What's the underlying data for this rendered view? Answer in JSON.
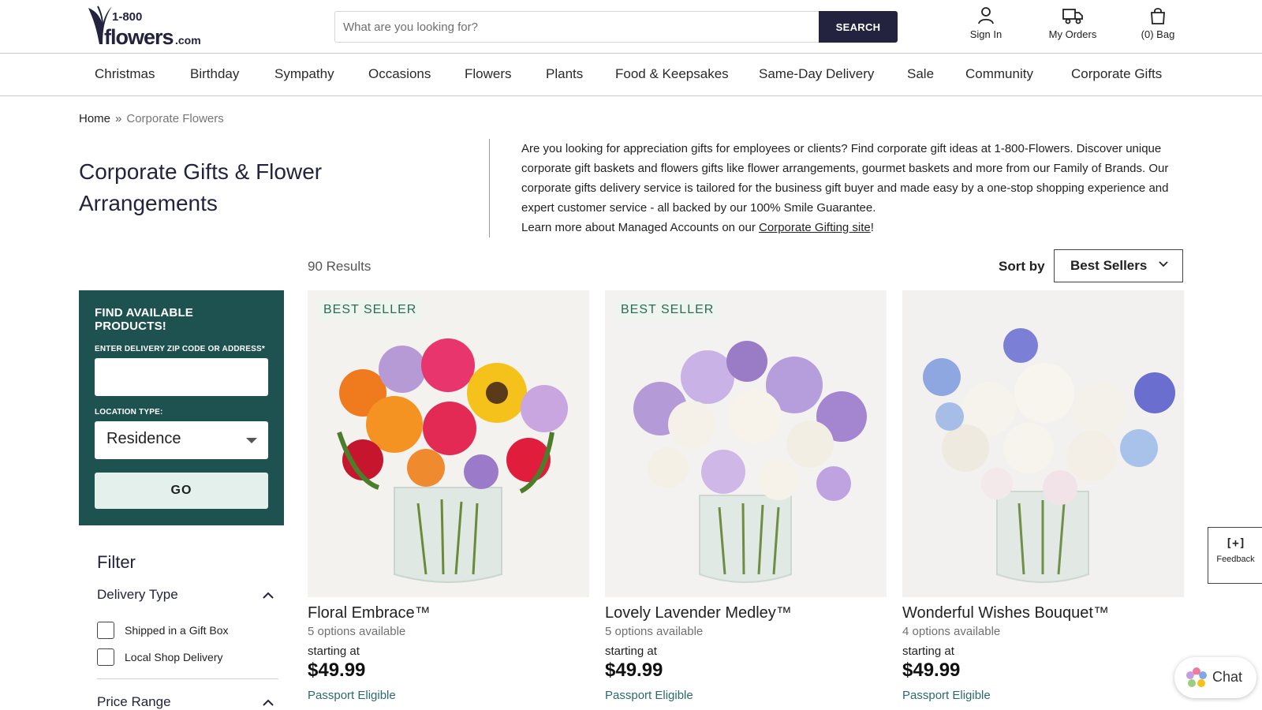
{
  "header": {
    "logo_text": "1-800-flowers.com",
    "search_placeholder": "What are you looking for?",
    "search_label": "SEARCH",
    "signin_label": "Sign In",
    "orders_label": "My Orders",
    "bag_label": "(0) Bag"
  },
  "nav": {
    "items": [
      "Christmas",
      "Birthday",
      "Sympathy",
      "Occasions",
      "Flowers",
      "Plants",
      "Food & Keepsakes",
      "Same-Day Delivery",
      "Sale",
      "Community",
      "Corporate Gifts"
    ]
  },
  "breadcrumb": {
    "home": "Home",
    "separator": "»",
    "current": "Corporate Flowers"
  },
  "page": {
    "title": "Corporate Gifts & Flower Arrangements",
    "description": "Are you looking for appreciation gifts for employees or clients? Find corporate gift ideas at 1-800-Flowers. Discover unique corporate gift baskets and flowers gifts like flower arrangements, gourmet baskets and more from our Family of Brands. Our corporate gifts delivery service is tailored for the business gift buyer and made easy by a one-stop shopping experience and expert customer service - all backed by our 100% Smile Guarantee.",
    "learn_more_prefix": "Learn more about Managed Accounts on our ",
    "learn_more_link": "Corporate Gifting site",
    "learn_more_suffix": "!"
  },
  "results": {
    "count_label": "90 Results",
    "sort_label": "Sort by",
    "sort_value": "Best Sellers"
  },
  "finder": {
    "title": "FIND AVAILABLE PRODUCTS!",
    "zip_label": "ENTER DELIVERY ZIP CODE OR ADDRESS*",
    "zip_value": "",
    "location_label": "LOCATION TYPE:",
    "location_value": "Residence",
    "go_label": "GO"
  },
  "filter": {
    "title": "Filter",
    "groups": [
      {
        "title": "Delivery Type",
        "options": [
          "Shipped in a Gift Box",
          "Local Shop Delivery"
        ]
      },
      {
        "title": "Price Range"
      }
    ]
  },
  "products": [
    {
      "badge": "BEST SELLER",
      "name": "Floral Embrace™",
      "options": "5 options available",
      "starting": "starting at",
      "price": "$49.99",
      "passport": "Passport Eligible"
    },
    {
      "badge": "BEST SELLER",
      "name": "Lovely Lavender Medley™",
      "options": "5 options available",
      "starting": "starting at",
      "price": "$49.99",
      "passport": "Passport Eligible"
    },
    {
      "badge": "",
      "name": "Wonderful Wishes Bouquet™",
      "options": "4 options available",
      "starting": "starting at",
      "price": "$49.99",
      "passport": "Passport Eligible"
    }
  ],
  "widgets": {
    "feedback_icon": "[+]",
    "feedback_label": "Feedback",
    "chat_label": "Chat"
  },
  "colors": {
    "brand_navy": "#23233f",
    "finder_teal": "#1e5251",
    "badge_bg": "#eef5ef",
    "passport_teal": "#2c6a6b"
  }
}
